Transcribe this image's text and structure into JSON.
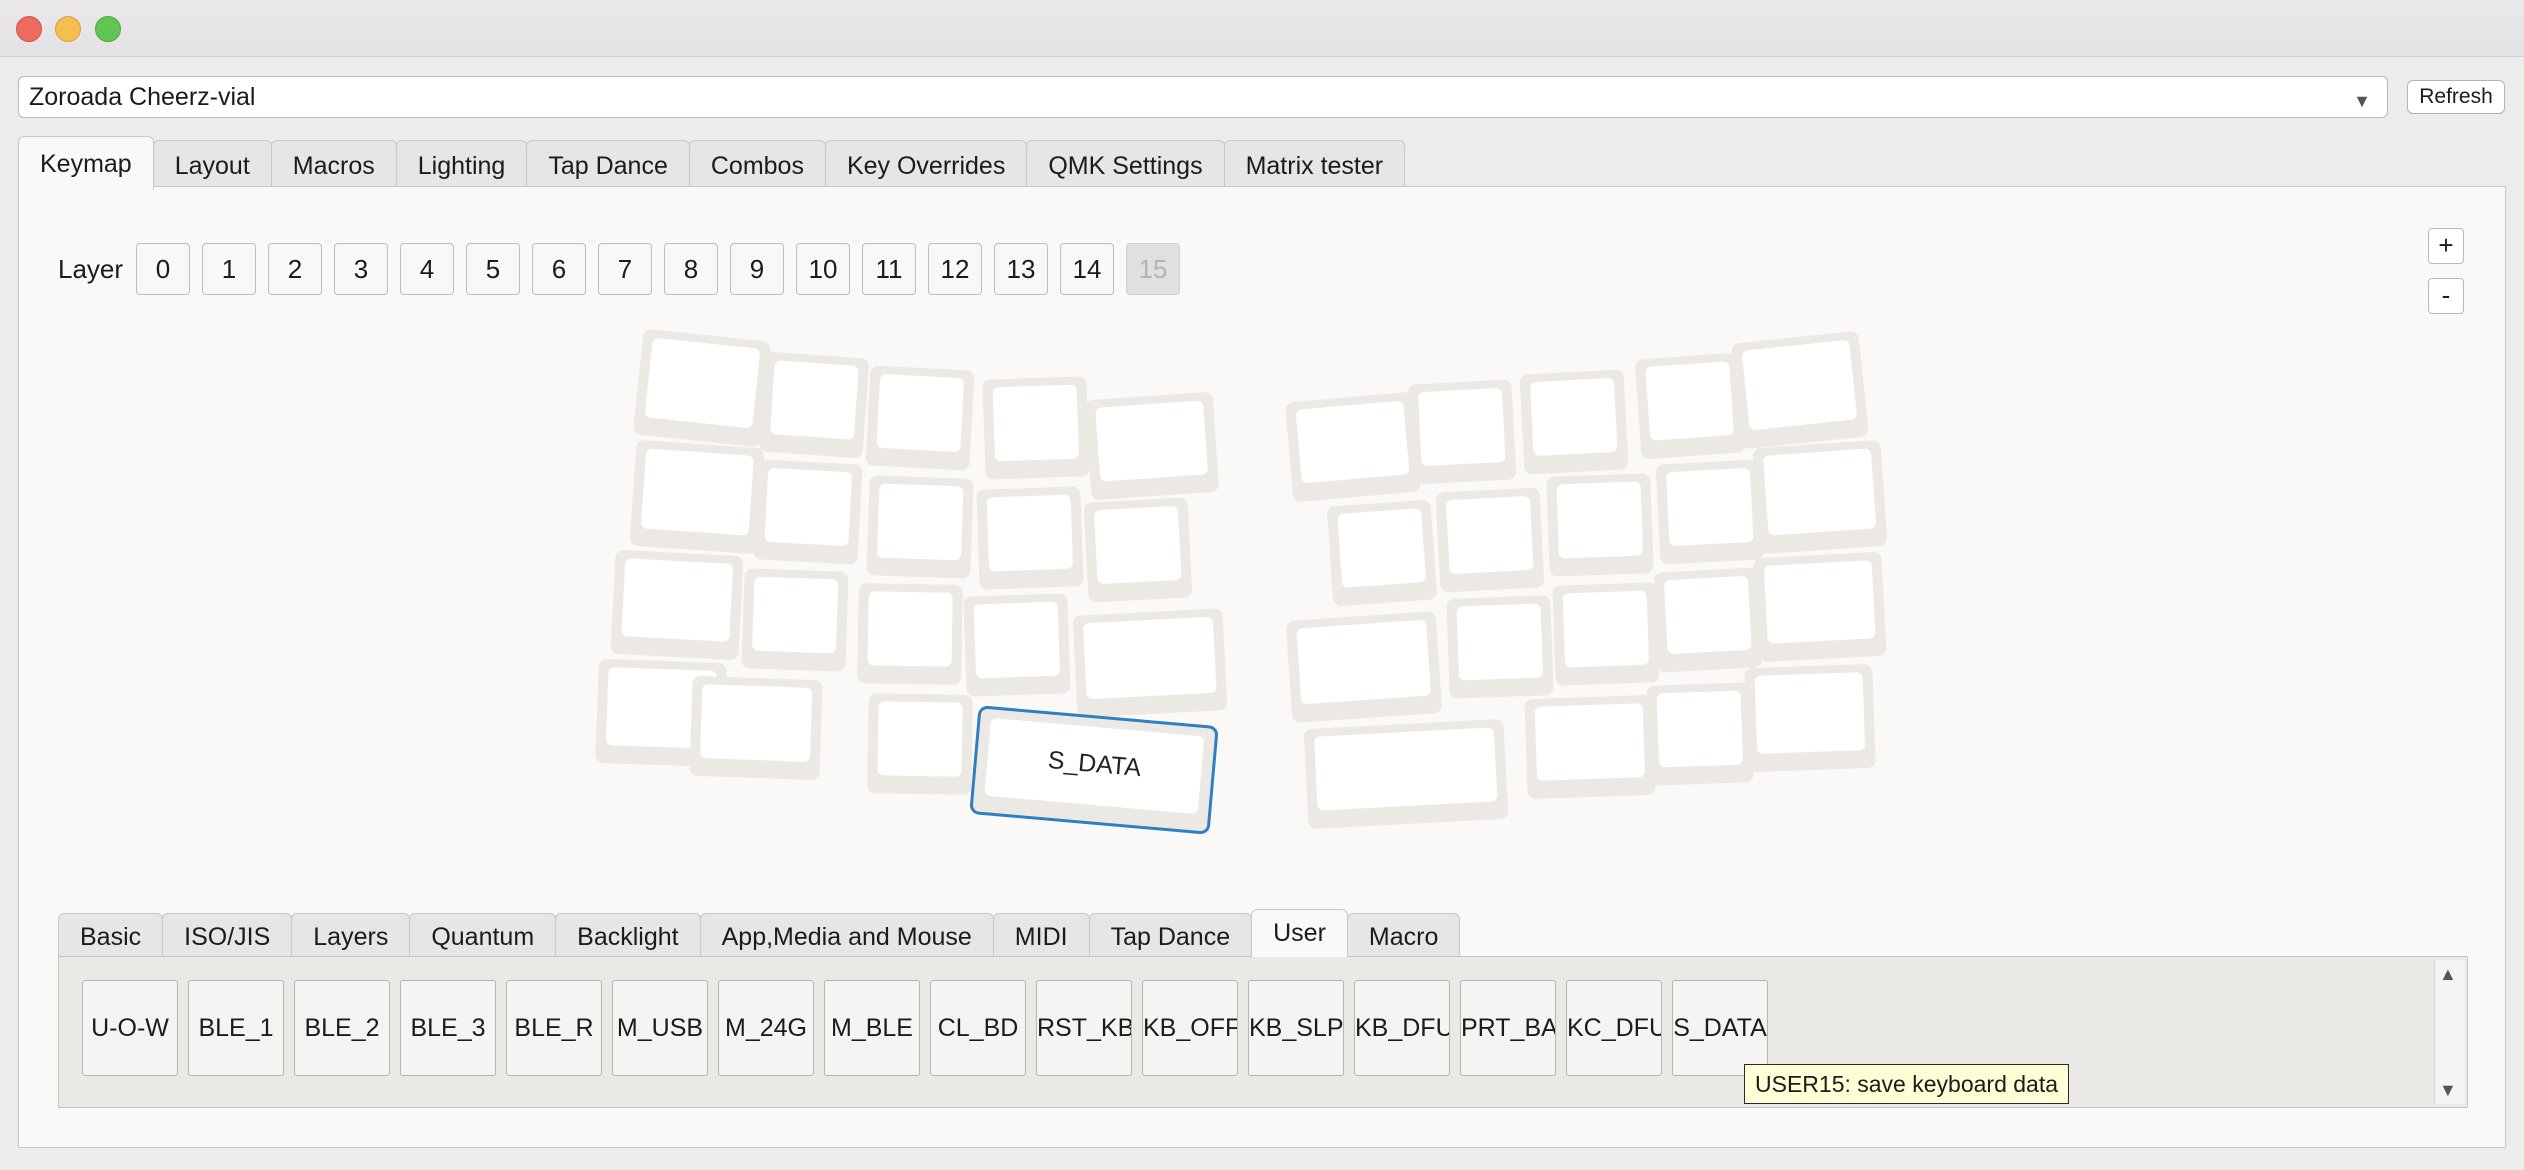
{
  "device": {
    "name": "Zoroada Cheerz-vial",
    "refresh_label": "Refresh"
  },
  "main_tabs": [
    "Keymap",
    "Layout",
    "Macros",
    "Lighting",
    "Tap Dance",
    "Combos",
    "Key Overrides",
    "QMK Settings",
    "Matrix tester"
  ],
  "active_main_tab": "Keymap",
  "layer": {
    "label": "Layer",
    "buttons": [
      "0",
      "1",
      "2",
      "3",
      "4",
      "5",
      "6",
      "7",
      "8",
      "9",
      "10",
      "11",
      "12",
      "13",
      "14",
      "15"
    ],
    "disabled": "15"
  },
  "zoom": {
    "in_label": "+",
    "out_label": "-"
  },
  "selected_key": {
    "label": "S_DATA"
  },
  "keycode_tabs": [
    "Basic",
    "ISO/JIS",
    "Layers",
    "Quantum",
    "Backlight",
    "App,Media and Mouse",
    "MIDI",
    "Tap Dance",
    "User",
    "Macro"
  ],
  "active_keycode_tab": "User",
  "keycodes": [
    "U-O-W",
    "BLE_1",
    "BLE_2",
    "BLE_3",
    "BLE_R",
    "M_USB",
    "M_24G",
    "M_BLE",
    "CL_BD",
    "RST_KB",
    "KB_OFF",
    "KB_SLP",
    "KB_DFU",
    "PRT_BAT",
    "KC_DFU",
    "S_DATA"
  ],
  "tooltip": "USER15: save keyboard data",
  "colors": {
    "selected_outline": "#2f7fc1",
    "key_outer": "#ece8e4",
    "key_inner": "#ffffff"
  }
}
